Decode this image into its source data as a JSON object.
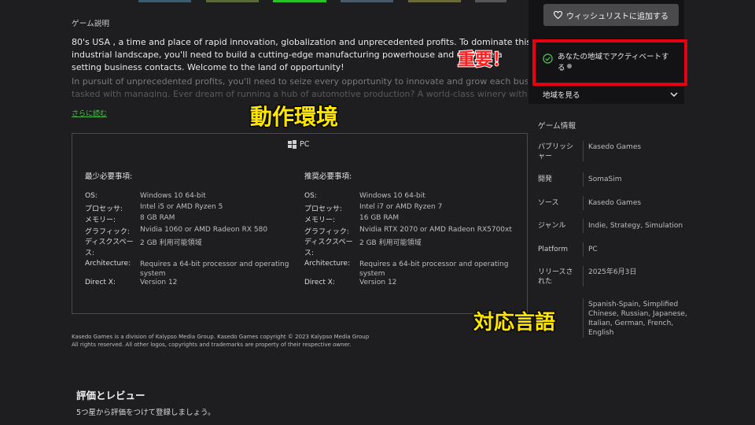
{
  "game_description": {
    "title": "ゲーム説明",
    "paragraph1_line1": "80's USA , a time and place of rapid innovation, globalization and unprecedented profits. To dominate this competitive",
    "paragraph1_line2": "industrial landscape, you'll need to build a cutting-edge manufacturing powerhouse and cultivate a",
    "paragraph1_line3": "setting business contacts. Welcome to the land of opportunity!",
    "paragraph2_line1": "In pursuit of unprecedented profits, you'll need to seize every opportunity to innovate and grow each business you're",
    "paragraph2_line2": "tasked with managing. Ever dream of running a hub of automotive production? A world-class winery with sweeping",
    "read_more": "さらに読む"
  },
  "requirements": {
    "platform": "PC",
    "minimum": {
      "heading": "最少必要事項:",
      "rows": [
        {
          "label": "OS:",
          "value": "Windows 10 64-bit"
        },
        {
          "label": "プロセッサ:",
          "value": "Intel i5 or AMD Ryzen 5"
        },
        {
          "label": "メモリー:",
          "value": "8 GB RAM"
        },
        {
          "label": "グラフィック:",
          "value": "Nvidia 1060 or AMD Radeon RX 580"
        },
        {
          "label": "ディスクスペース:",
          "value": "2 GB 利用可能領域"
        },
        {
          "label": "Architecture:",
          "value": "Requires a 64-bit processor and operating system"
        },
        {
          "label": "Direct X:",
          "value": "Version 12"
        }
      ]
    },
    "recommended": {
      "heading": "推奨必要事項:",
      "rows": [
        {
          "label": "OS:",
          "value": "Windows 10 64-bit"
        },
        {
          "label": "プロセッサ:",
          "value": "Intel i7 or AMD Ryzen 7"
        },
        {
          "label": "メモリー:",
          "value": "16 GB RAM"
        },
        {
          "label": "グラフィック:",
          "value": "Nvidia RTX 2070 or AMD Radeon RX5700xt"
        },
        {
          "label": "ディスクスペース:",
          "value": "2 GB 利用可能領域"
        },
        {
          "label": "Architecture:",
          "value": "Requires a 64-bit processor and operating system"
        },
        {
          "label": "Direct X:",
          "value": "Version 12"
        }
      ]
    }
  },
  "footer": {
    "line1": "Kasedo Games is a division of Kalypso Media Group. Kasedo Games copyright © 2023 Kalypso Media Group",
    "line2": "All rights reserved. All other logos, copyrights and trademarks are property of their respective owner."
  },
  "reviews": {
    "title": "評価とレビュー",
    "subtitle": "5つ星から評価をつけて登録しましょう。"
  },
  "sidebar": {
    "wishlist_button": "ウィッシュリストに追加する",
    "activation_line1": "あなたの地域でアクティベートす",
    "activation_line2": "る",
    "region_button": "地域を見る"
  },
  "game_info": {
    "title": "ゲーム情報",
    "publisher_label_1": "パブリッシ",
    "publisher_label_2": "ャー",
    "publisher": "Kasedo Games",
    "developer_label": "開発",
    "developer": "SomaSim",
    "source_label": "ソース",
    "source": "Kasedo Games",
    "genre_label": "ジャンル",
    "genre": "Indie, Strategy, Simulation",
    "platform_label": "Platform",
    "platform": "PC",
    "release_label_1": "リリースさ",
    "release_label_2": "れた",
    "release": "2025年6月3日",
    "languages_line1": "Spanish-Spain, Simplified",
    "languages_line2": "Chinese, Russian, Japanese,",
    "languages_line3": "Italian, German, French,",
    "languages_line4": "English"
  },
  "annotations": {
    "important": "重要！",
    "system_requirements": "動作環境",
    "supported_languages": "対応言語"
  },
  "colors": {
    "background": "#1e1e20",
    "sidebar": "#131315",
    "accent_green": "#4dbb4d",
    "highlight_red": "#e60012",
    "annotation_yellow": "#ffe600"
  }
}
